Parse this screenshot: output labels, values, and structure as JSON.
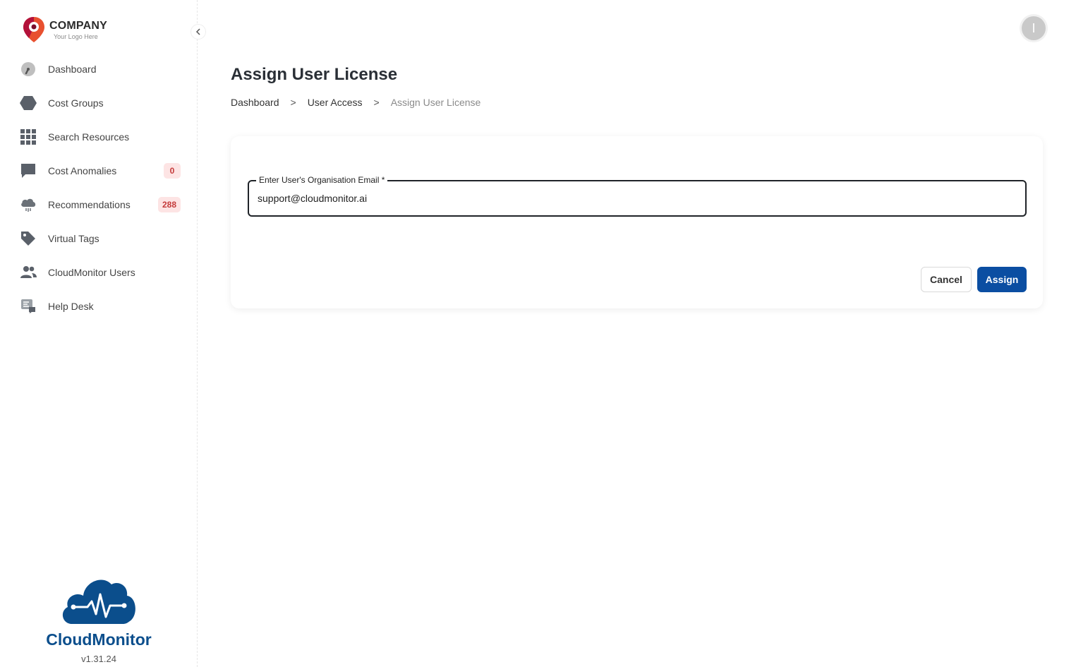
{
  "logo": {
    "title": "COMPANY",
    "subtitle": "Your Logo Here"
  },
  "sidebar": {
    "items": [
      {
        "label": "Dashboard",
        "icon": "gauge-icon"
      },
      {
        "label": "Cost Groups",
        "icon": "hexagon-icon"
      },
      {
        "label": "Search Resources",
        "icon": "grid-icon"
      },
      {
        "label": "Cost Anomalies",
        "icon": "chat-icon",
        "badge": "0"
      },
      {
        "label": "Recommendations",
        "icon": "cloud-icon",
        "badge": "288"
      },
      {
        "label": "Virtual Tags",
        "icon": "tag-icon"
      },
      {
        "label": "CloudMonitor Users",
        "icon": "users-icon"
      },
      {
        "label": "Help Desk",
        "icon": "helpdesk-icon"
      }
    ],
    "collapse_icon": "chevron-left-icon"
  },
  "brand": {
    "name": "CloudMonitor",
    "version": "v1.31.24"
  },
  "header": {
    "avatar_initial": "I"
  },
  "page": {
    "title": "Assign User License",
    "breadcrumb": [
      "Dashboard",
      "User Access",
      "Assign User License"
    ],
    "breadcrumb_separator": ">"
  },
  "form": {
    "email_label": "Enter User's Organisation Email *",
    "email_value": "support@cloudmonitor.ai",
    "cancel_label": "Cancel",
    "assign_label": "Assign"
  },
  "colors": {
    "primary": "#0b4ea2",
    "brand": "#0b4e8c",
    "badge_bg": "#fde4e4",
    "badge_text": "#c43a3a"
  }
}
